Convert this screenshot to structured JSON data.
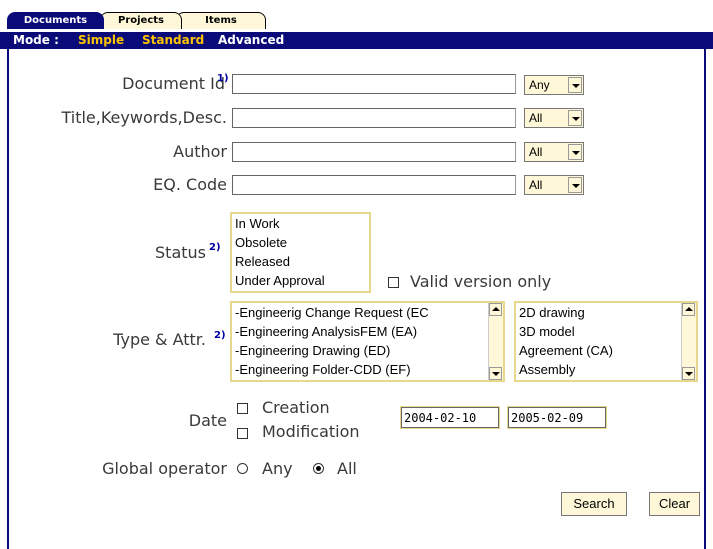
{
  "tabs": {
    "documents": "Documents",
    "projects": "Projects",
    "items": "Items"
  },
  "mode": {
    "label": "Mode :",
    "simple": "Simple",
    "standard": "Standard",
    "advanced": "Advanced"
  },
  "form": {
    "document_id": {
      "label": "Document Id",
      "note": "1)",
      "value": "",
      "operator": "Any"
    },
    "title": {
      "label": "Title,Keywords,Desc.",
      "value": "",
      "operator": "All"
    },
    "author": {
      "label": "Author",
      "value": "",
      "operator": "All"
    },
    "eq_code": {
      "label": "EQ. Code",
      "value": "",
      "operator": "All"
    },
    "status": {
      "label": "Status",
      "note": "2)",
      "options": [
        "In Work",
        "Obsolete",
        "Released",
        "Under Approval"
      ],
      "valid_version_label": "Valid version only"
    },
    "type_attr": {
      "label": "Type & Attr.",
      "note": "2)",
      "types": [
        "-Engineerig Change Request (EC",
        "-Engineering AnalysisFEM (EA)",
        "-Engineering Drawing (ED)",
        "-Engineering Folder-CDD (EF)"
      ],
      "attrs": [
        "2D drawing",
        "3D model",
        "Agreement (CA)",
        "Assembly"
      ]
    },
    "date": {
      "label": "Date",
      "creation": "Creation",
      "modification": "Modification",
      "from": "2004-02-10",
      "to": "2005-02-09"
    },
    "global_operator": {
      "label": "Global operator",
      "any": "Any",
      "all": "All",
      "selected": "All"
    },
    "search_button": "Search",
    "clear_button": "Clear"
  },
  "colors": {
    "navy": "#0a0a78",
    "gold": "#ffc400",
    "pale_yellow": "#fff8d8"
  }
}
